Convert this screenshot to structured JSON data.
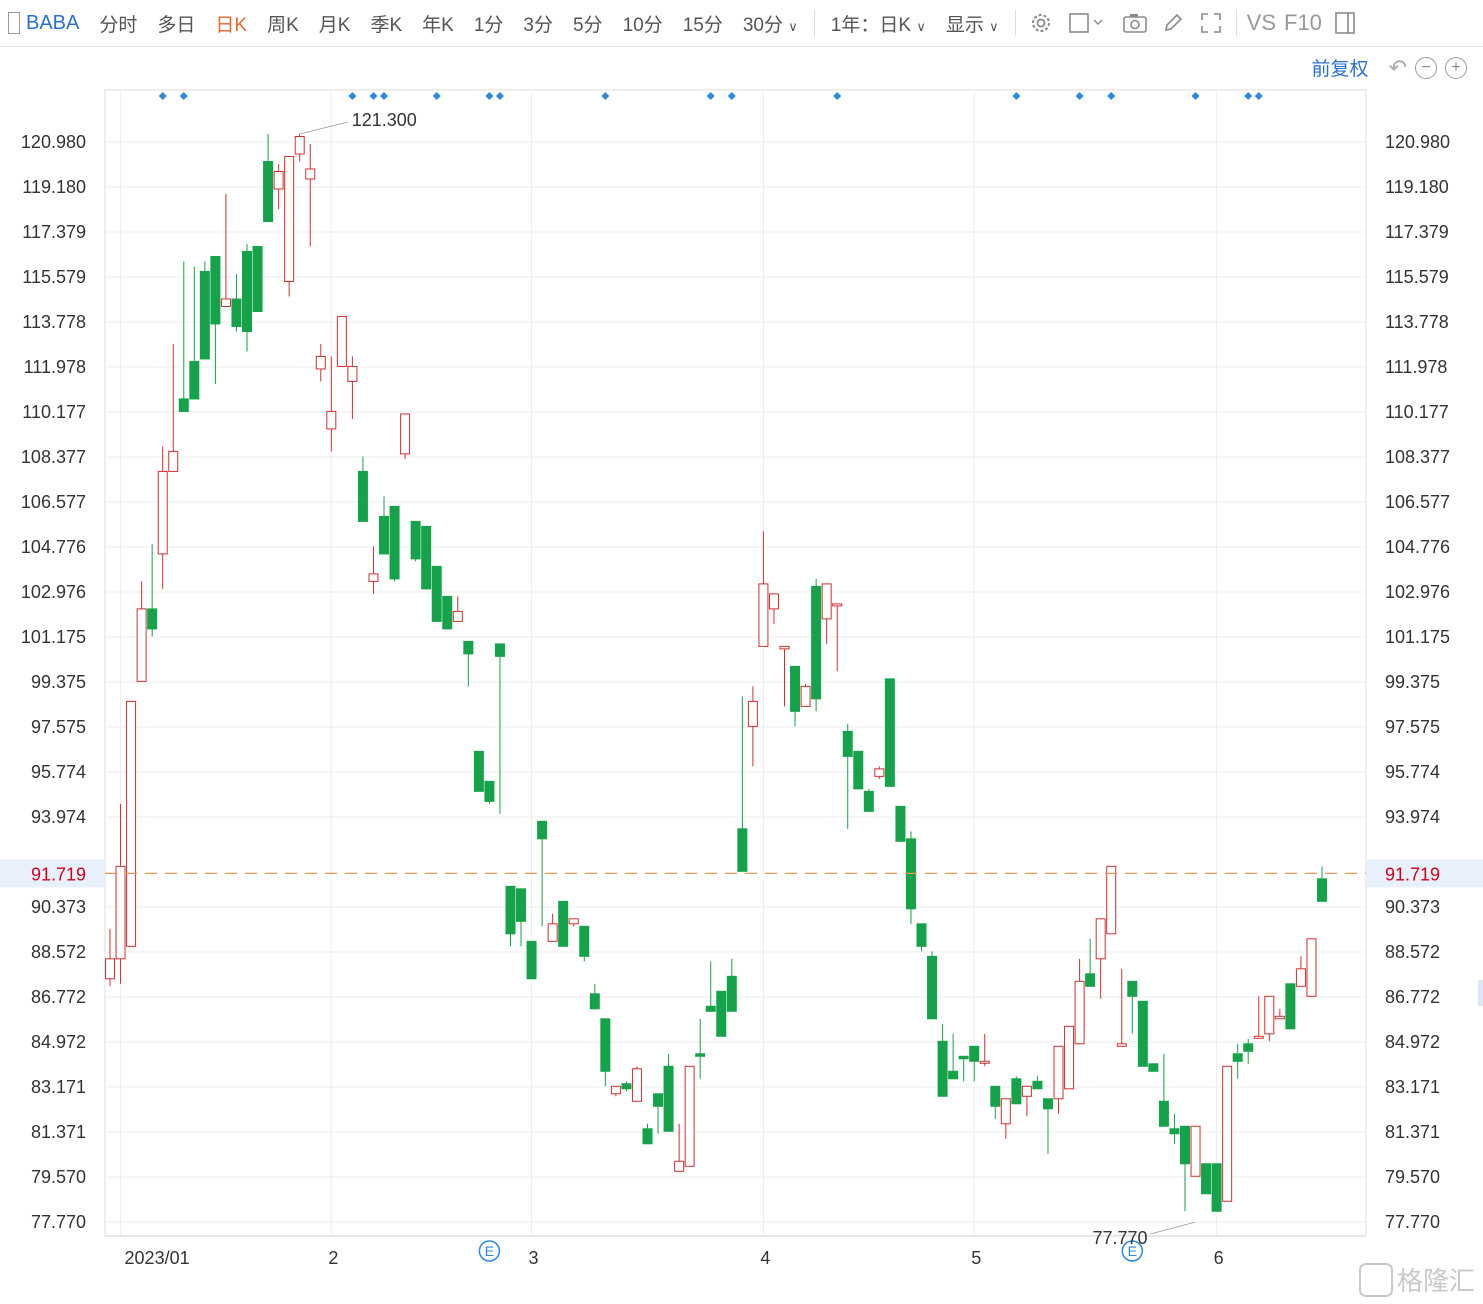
{
  "toolbar": {
    "symbol": "BABA",
    "tabs": [
      "分时",
      "多日",
      "日K",
      "周K",
      "月K",
      "季K",
      "年K",
      "1分",
      "3分",
      "5分",
      "10分",
      "15分",
      "30分"
    ],
    "active_tab": "日K",
    "range_select": "1年：日K",
    "display_select": "显示",
    "vs_label": "VS",
    "f10_label": "F10",
    "icons": [
      "panel-toggle-icon",
      "settings-gear-icon",
      "rectangle-tool-icon",
      "camera-icon",
      "pencil-icon",
      "fullscreen-icon",
      "sidebar-icon"
    ]
  },
  "adjust": {
    "label": "前复权",
    "icons": [
      "undo-icon",
      "zoom-out-icon",
      "zoom-in-icon"
    ]
  },
  "watermark": "格隆汇",
  "colors": {
    "up": "#d32f2f",
    "down": "#15a24a",
    "price_line": "#e8955a",
    "price_label": "#d0021b",
    "price_bg": "#e8f0fc",
    "event_marker": "#2a8ae0",
    "grid": "#eeeeee"
  },
  "chart_data": {
    "type": "candlestick",
    "symbol": "BABA",
    "interval": "日K",
    "adjustment": "前复权",
    "y_ticks": [
      "120.980",
      "119.180",
      "117.379",
      "115.579",
      "113.778",
      "111.978",
      "110.177",
      "108.377",
      "106.577",
      "104.776",
      "102.976",
      "101.175",
      "99.375",
      "97.575",
      "95.774",
      "93.974",
      "90.373",
      "88.572",
      "86.772",
      "84.972",
      "83.171",
      "81.371",
      "79.570",
      "77.770"
    ],
    "ylim": [
      77.77,
      120.98
    ],
    "x_labels": [
      "2023/01",
      "2",
      "3",
      "4",
      "5",
      "6"
    ],
    "current_price": "91.719",
    "high_annotation": "121.300",
    "low_annotation": "77.770",
    "earnings_marker": "E",
    "event_marker_count": 20,
    "candles": [
      [
        87.5,
        89.5,
        87.2,
        88.3
      ],
      [
        88.3,
        94.5,
        87.3,
        92.0
      ],
      [
        88.8,
        98.6,
        97.7,
        98.6
      ],
      [
        99.4,
        103.4,
        103.4,
        102.3
      ],
      [
        102.3,
        104.9,
        101.2,
        101.5
      ],
      [
        104.5,
        108.8,
        103.1,
        107.8
      ],
      [
        107.8,
        112.9,
        111.3,
        108.6
      ],
      [
        110.7,
        116.2,
        114.9,
        110.2
      ],
      [
        112.2,
        116.0,
        115.3,
        110.7
      ],
      [
        115.8,
        116.2,
        115.3,
        112.3
      ],
      [
        116.4,
        113.4,
        111.3,
        113.7
      ],
      [
        114.4,
        118.9,
        117.1,
        114.7
      ],
      [
        114.7,
        115.7,
        113.4,
        113.6
      ],
      [
        116.6,
        116.9,
        112.6,
        113.4
      ],
      [
        116.8,
        115.7,
        115.9,
        114.2
      ],
      [
        120.2,
        121.3,
        118.5,
        117.8
      ],
      [
        119.1,
        118.3,
        120.1,
        119.8
      ],
      [
        115.4,
        120.2,
        114.8,
        120.4
      ],
      [
        120.5,
        120.2,
        121.3,
        121.2
      ],
      [
        119.5,
        120.9,
        116.8,
        119.9
      ],
      [
        111.9,
        112.9,
        111.4,
        112.4
      ],
      [
        109.5,
        112.4,
        108.6,
        110.2
      ],
      [
        112.0,
        113.3,
        113.6,
        114.0
      ],
      [
        111.4,
        112.4,
        109.9,
        112.0
      ],
      [
        107.8,
        106.2,
        108.4,
        105.8
      ],
      [
        103.4,
        104.8,
        102.9,
        103.7
      ],
      [
        106.0,
        105.1,
        106.8,
        104.5
      ],
      [
        106.4,
        104.5,
        103.4,
        103.5
      ],
      [
        108.5,
        108.3,
        108.8,
        110.1
      ],
      [
        105.8,
        105.1,
        104.2,
        104.3
      ],
      [
        105.6,
        104.3,
        103.8,
        103.1
      ],
      [
        104.0,
        104.0,
        103.3,
        101.8
      ],
      [
        102.8,
        102.8,
        102.1,
        101.5
      ],
      [
        101.8,
        102.8,
        101.9,
        102.2
      ],
      [
        101.0,
        100.2,
        99.2,
        100.5
      ],
      [
        96.6,
        95.0,
        95.4,
        95.0
      ],
      [
        95.4,
        94.7,
        94.5,
        94.6
      ],
      [
        100.9,
        94.1,
        94.1,
        100.4
      ],
      [
        91.2,
        90.3,
        88.8,
        89.3
      ],
      [
        91.1,
        89.5,
        88.8,
        89.8
      ],
      [
        89.0,
        88.4,
        88.3,
        87.5
      ],
      [
        93.8,
        89.6,
        92.6,
        93.1
      ],
      [
        89.0,
        89.7,
        90.1,
        89.7
      ],
      [
        90.6,
        89.6,
        89.8,
        88.8
      ],
      [
        89.7,
        89.8,
        89.6,
        89.9
      ],
      [
        89.6,
        88.2,
        89.3,
        88.4
      ],
      [
        86.9,
        86.4,
        87.3,
        86.3
      ],
      [
        85.9,
        83.2,
        85.0,
        83.8
      ],
      [
        82.9,
        82.8,
        83.0,
        83.2
      ],
      [
        83.3,
        83.4,
        83.0,
        83.1
      ],
      [
        82.6,
        84.0,
        83.4,
        83.9
      ],
      [
        81.5,
        81.3,
        81.7,
        80.9
      ],
      [
        82.9,
        82.1,
        81.3,
        82.4
      ],
      [
        84.0,
        83.9,
        84.5,
        81.4
      ],
      [
        79.8,
        81.7,
        80.7,
        80.2
      ],
      [
        80.0,
        83.9,
        82.4,
        84.0
      ],
      [
        84.5,
        83.5,
        85.9,
        84.4
      ],
      [
        86.4,
        88.2,
        87.4,
        86.2
      ],
      [
        87.0,
        85.7,
        86.3,
        85.2
      ],
      [
        87.6,
        88.3,
        88.0,
        86.2
      ],
      [
        93.5,
        98.8,
        97.2,
        91.8
      ],
      [
        97.6,
        99.2,
        96.0,
        98.6
      ],
      [
        100.8,
        103.2,
        105.4,
        103.3
      ],
      [
        102.3,
        102.4,
        101.7,
        102.9
      ],
      [
        100.7,
        98.4,
        98.5,
        100.8
      ],
      [
        100.0,
        97.6,
        99.0,
        98.2
      ],
      [
        98.4,
        98.6,
        99.3,
        99.2
      ],
      [
        103.2,
        103.5,
        98.2,
        98.7
      ],
      [
        101.9,
        100.9,
        101.2,
        103.3
      ],
      [
        102.5,
        99.8,
        102.2,
        102.5
      ],
      [
        97.4,
        97.7,
        93.5,
        96.4
      ],
      [
        96.6,
        95.7,
        95.5,
        95.1
      ],
      [
        95.0,
        95.1,
        94.9,
        94.2
      ],
      [
        95.6,
        96.0,
        95.5,
        95.9
      ],
      [
        99.5,
        98.4,
        98.9,
        95.2
      ],
      [
        94.4,
        94.3,
        93.9,
        93.0
      ],
      [
        93.1,
        93.4,
        89.7,
        90.3
      ],
      [
        89.7,
        88.6,
        89.1,
        88.8
      ],
      [
        88.4,
        88.6,
        87.7,
        85.9
      ],
      [
        85.0,
        84.8,
        85.7,
        82.8
      ],
      [
        83.8,
        85.3,
        84.5,
        83.5
      ],
      [
        84.4,
        83.6,
        83.4,
        84.3
      ],
      [
        84.8,
        83.4,
        83.8,
        84.2
      ],
      [
        84.2,
        85.3,
        84.0,
        84.2
      ],
      [
        83.2,
        81.9,
        82.1,
        82.4
      ],
      [
        81.7,
        81.1,
        82.7,
        82.7
      ],
      [
        83.5,
        83.6,
        83.6,
        82.5
      ],
      [
        82.8,
        82.0,
        82.3,
        83.2
      ],
      [
        83.4,
        83.5,
        83.6,
        83.1
      ],
      [
        82.7,
        81.6,
        80.5,
        82.3
      ],
      [
        82.7,
        82.1,
        83.4,
        84.8
      ],
      [
        83.1,
        85.6,
        84.1,
        85.6
      ],
      [
        84.9,
        88.3,
        85.7,
        87.4
      ],
      [
        87.7,
        89.1,
        87.6,
        87.2
      ],
      [
        88.3,
        87.5,
        86.7,
        89.9
      ],
      [
        89.3,
        89.9,
        91.5,
        92.0
      ],
      [
        84.8,
        87.9,
        84.8,
        84.9
      ],
      [
        87.4,
        85.3,
        85.3,
        86.8
      ],
      [
        86.6,
        86.3,
        84.0,
        84.0
      ],
      [
        84.1,
        84.1,
        84.1,
        83.8
      ],
      [
        82.6,
        84.5,
        83.7,
        81.6
      ],
      [
        81.5,
        82.1,
        80.9,
        81.3
      ],
      [
        81.6,
        78.2,
        80.0,
        80.1
      ],
      [
        79.6,
        81.3,
        79.7,
        81.6
      ],
      [
        80.1,
        78.9,
        80.1,
        78.9
      ],
      [
        80.1,
        79.9,
        79.2,
        78.2
      ],
      [
        78.6,
        84.0,
        84.0,
        84.0
      ],
      [
        84.5,
        83.5,
        84.9,
        84.2
      ],
      [
        84.9,
        85.1,
        84.1,
        84.6
      ],
      [
        85.2,
        86.8,
        86.2,
        85.2
      ],
      [
        85.3,
        86.2,
        85.0,
        86.8
      ],
      [
        85.9,
        86.3,
        86.0,
        86.0
      ],
      [
        87.3,
        87.1,
        87.3,
        85.5
      ],
      [
        87.2,
        88.4,
        88.0,
        87.9
      ],
      [
        86.8,
        88.5,
        87.8,
        89.1
      ],
      [
        91.5,
        91.8,
        92.0,
        90.6
      ]
    ]
  }
}
